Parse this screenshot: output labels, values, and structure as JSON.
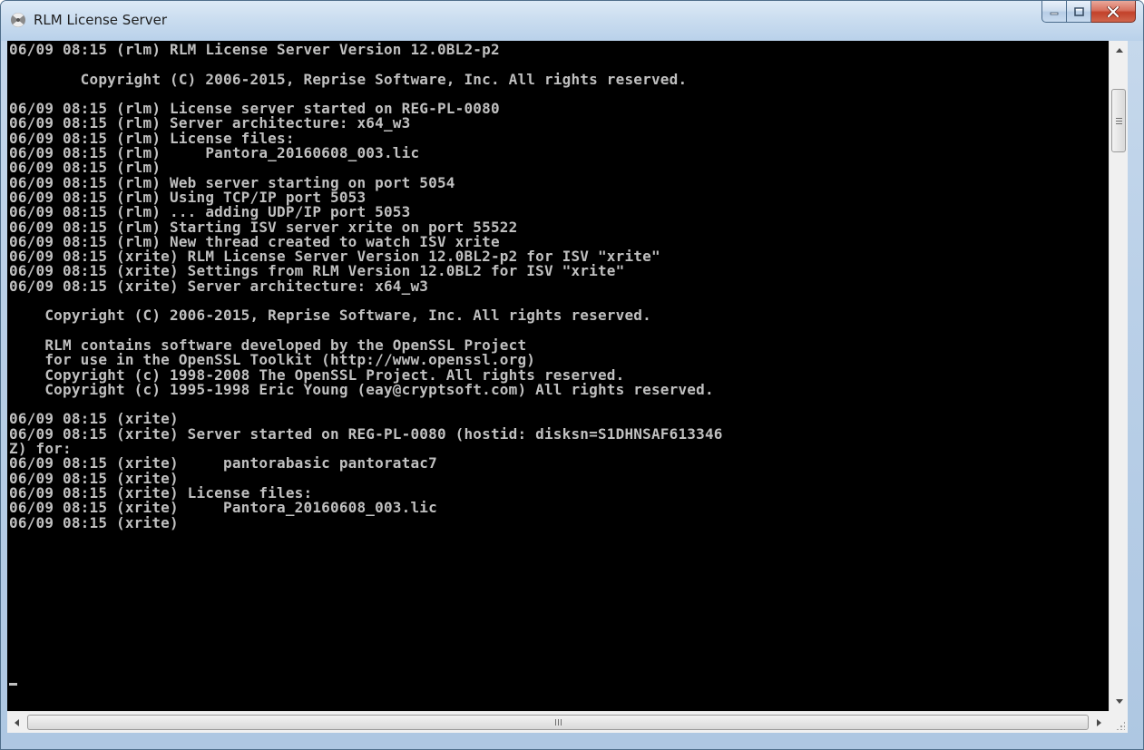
{
  "window": {
    "title": "RLM License Server",
    "icon": "rlm-app-icon",
    "controls": {
      "minimize_icon": "minimize-icon",
      "maximize_icon": "maximize-icon",
      "close_icon": "close-icon"
    }
  },
  "colors": {
    "console_bg": "#000000",
    "console_text": "#c0c0c0",
    "close_button": "#c2412a"
  },
  "console": {
    "lines": [
      "06/09 08:15 (rlm) RLM License Server Version 12.0BL2-p2",
      "",
      "        Copyright (C) 2006-2015, Reprise Software, Inc. All rights reserved.",
      "",
      "06/09 08:15 (rlm) License server started on REG-PL-0080",
      "06/09 08:15 (rlm) Server architecture: x64_w3",
      "06/09 08:15 (rlm) License files:",
      "06/09 08:15 (rlm)     Pantora_20160608_003.lic",
      "06/09 08:15 (rlm)",
      "06/09 08:15 (rlm) Web server starting on port 5054",
      "06/09 08:15 (rlm) Using TCP/IP port 5053",
      "06/09 08:15 (rlm) ... adding UDP/IP port 5053",
      "06/09 08:15 (rlm) Starting ISV server xrite on port 55522",
      "06/09 08:15 (rlm) New thread created to watch ISV xrite",
      "06/09 08:15 (xrite) RLM License Server Version 12.0BL2-p2 for ISV \"xrite\"",
      "06/09 08:15 (xrite) Settings from RLM Version 12.0BL2 for ISV \"xrite\"",
      "06/09 08:15 (xrite) Server architecture: x64_w3",
      "",
      "    Copyright (C) 2006-2015, Reprise Software, Inc. All rights reserved.",
      "",
      "    RLM contains software developed by the OpenSSL Project",
      "    for use in the OpenSSL Toolkit (http://www.openssl.org)",
      "    Copyright (c) 1998-2008 The OpenSSL Project. All rights reserved.",
      "    Copyright (c) 1995-1998 Eric Young (eay@cryptsoft.com) All rights reserved.",
      "",
      "06/09 08:15 (xrite)",
      "06/09 08:15 (xrite) Server started on REG-PL-0080 (hostid: disksn=S1DHNSAF613346",
      "Z) for:",
      "06/09 08:15 (xrite)     pantorabasic pantoratac7",
      "06/09 08:15 (xrite)",
      "06/09 08:15 (xrite) License files:",
      "06/09 08:15 (xrite)     Pantora_20160608_003.lic",
      "06/09 08:15 (xrite)"
    ]
  },
  "scrollbars": {
    "vertical": {
      "up_icon": "scroll-up-arrow-icon",
      "down_icon": "scroll-down-arrow-icon"
    },
    "horizontal": {
      "left_icon": "scroll-left-arrow-icon",
      "right_icon": "scroll-right-arrow-icon"
    }
  }
}
